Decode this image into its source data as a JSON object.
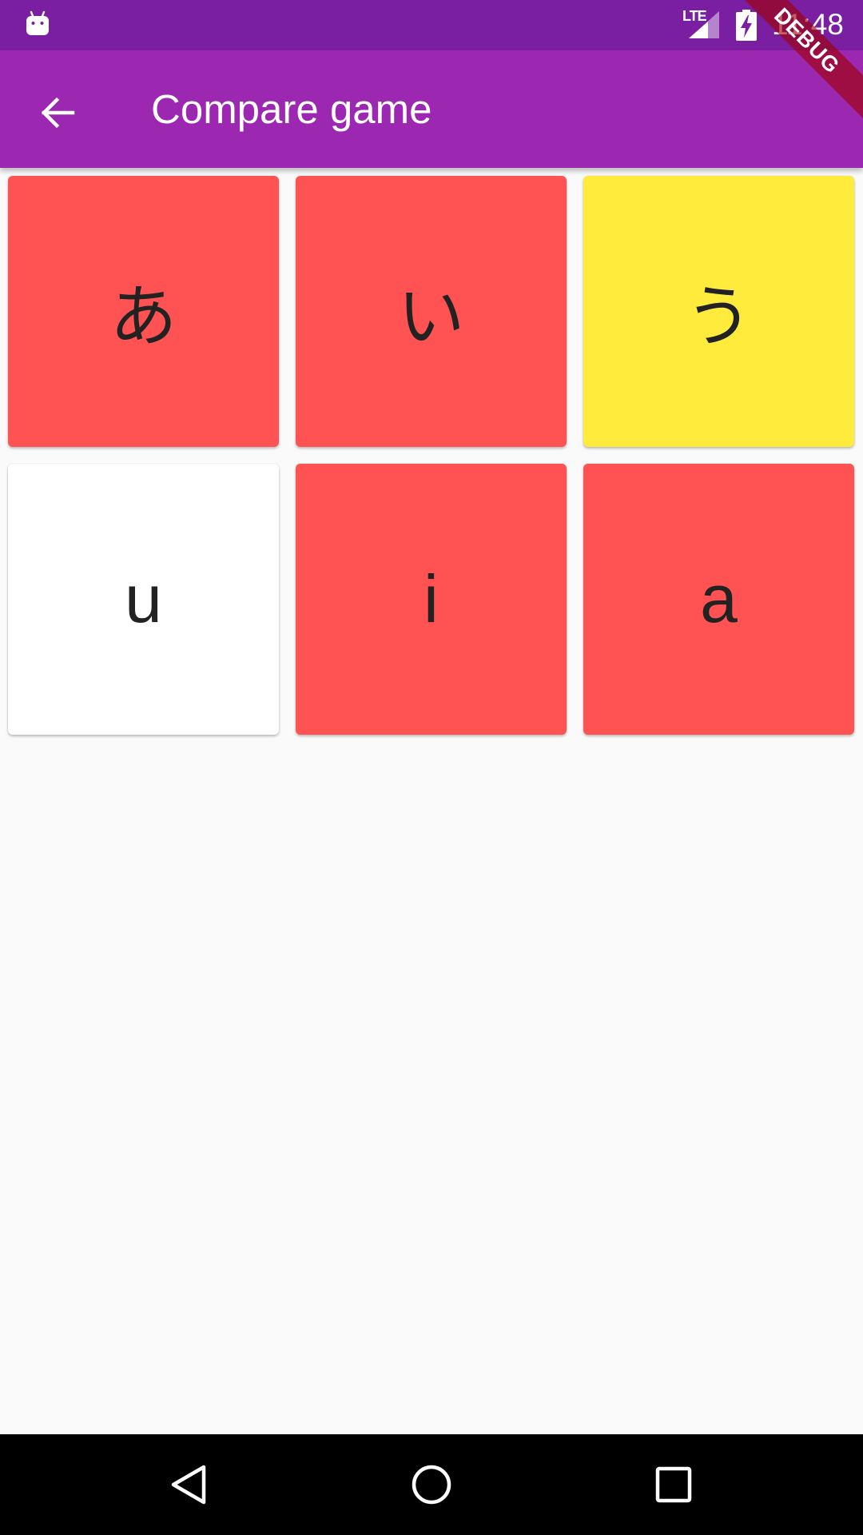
{
  "status_bar": {
    "network": "LTE",
    "time": "11:48",
    "icons": [
      "android-notification-icon",
      "signal-icon",
      "battery-charging-icon"
    ]
  },
  "app_bar": {
    "title": "Compare game",
    "back_icon": "arrow-back-icon"
  },
  "debug_banner": "DEBUG",
  "cards": [
    {
      "text": "あ",
      "color": "#ff5252",
      "state": "red"
    },
    {
      "text": "い",
      "color": "#ff5252",
      "state": "red"
    },
    {
      "text": "う",
      "color": "#ffeb3b",
      "state": "yellow"
    },
    {
      "text": "u",
      "color": "#ffffff",
      "state": "white"
    },
    {
      "text": "i",
      "color": "#ff5252",
      "state": "red"
    },
    {
      "text": "a",
      "color": "#ff5252",
      "state": "red"
    }
  ],
  "nav_bar": {
    "buttons": [
      "nav-back-icon",
      "nav-home-icon",
      "nav-recents-icon"
    ]
  },
  "colors": {
    "status_bar": "#7b1fa2",
    "app_bar": "#9c27b0",
    "background": "#fafafa",
    "card_red": "#ff5252",
    "card_yellow": "#ffeb3b",
    "card_white": "#ffffff"
  }
}
